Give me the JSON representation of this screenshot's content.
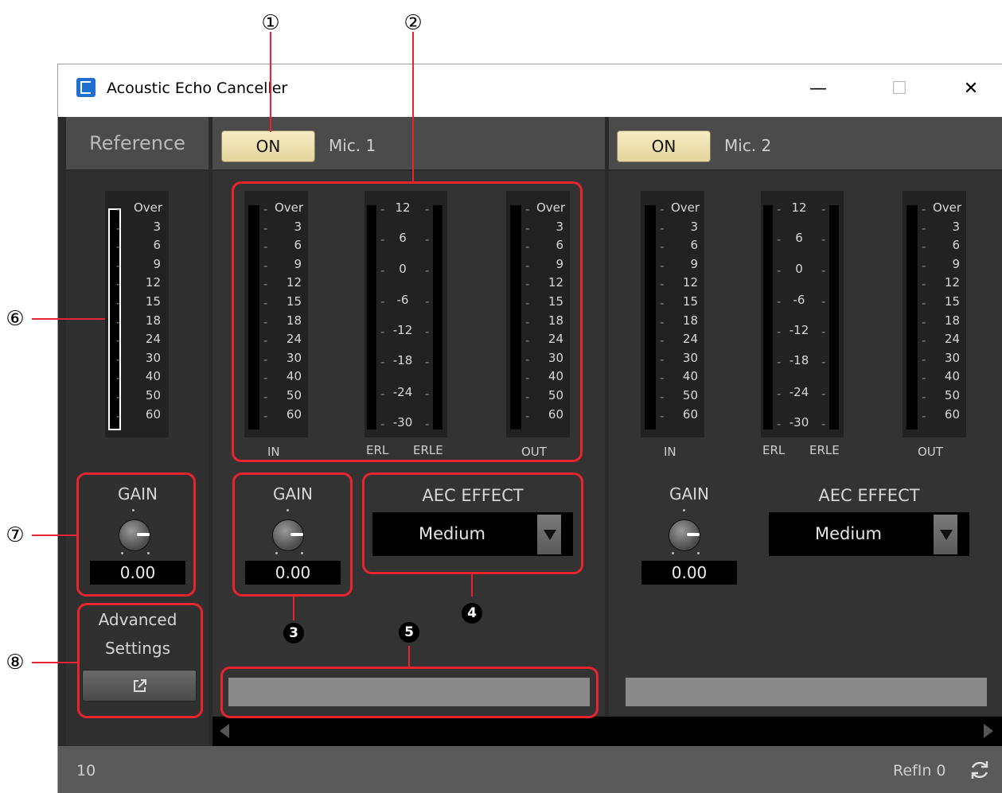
{
  "window": {
    "title": "Acoustic Echo Canceller",
    "minimize": "—",
    "maximize": "☐",
    "close": "✕"
  },
  "reference": {
    "title": "Reference",
    "meter_ticks": [
      "Over",
      "3",
      "6",
      "9",
      "12",
      "15",
      "18",
      "24",
      "30",
      "40",
      "50",
      "60"
    ],
    "gain_label": "GAIN",
    "gain_value": "0.00",
    "advanced_line1": "Advanced",
    "advanced_line2": "Settings",
    "advanced_button_icon": "external-link-icon"
  },
  "channels": [
    {
      "on_label": "ON",
      "mic_label": "Mic. 1",
      "level_ticks": [
        "Over",
        "3",
        "6",
        "9",
        "12",
        "15",
        "18",
        "24",
        "30",
        "40",
        "50",
        "60"
      ],
      "erl_ticks": [
        "12",
        "6",
        "0",
        "-6",
        "-12",
        "-18",
        "-24",
        "-30"
      ],
      "foot_in": "IN",
      "foot_erl": "ERL",
      "foot_erle": "ERLE",
      "foot_out": "OUT",
      "gain_label": "GAIN",
      "gain_value": "0.00",
      "aec_label": "AEC EFFECT",
      "aec_value": "Medium"
    },
    {
      "on_label": "ON",
      "mic_label": "Mic. 2",
      "level_ticks": [
        "Over",
        "3",
        "6",
        "9",
        "12",
        "15",
        "18",
        "24",
        "30",
        "40",
        "50",
        "60"
      ],
      "erl_ticks": [
        "12",
        "6",
        "0",
        "-6",
        "-12",
        "-18",
        "-24",
        "-30"
      ],
      "foot_in": "IN",
      "foot_erl": "ERL",
      "foot_erle": "ERLE",
      "foot_out": "OUT",
      "gain_label": "GAIN",
      "gain_value": "0.00",
      "aec_label": "AEC EFFECT",
      "aec_value": "Medium"
    }
  ],
  "footer": {
    "left": "10",
    "right": "RefIn 0",
    "refresh_icon": "refresh-icon"
  },
  "callouts": {
    "n1": "①",
    "n2": "②",
    "n3": "3",
    "n4": "4",
    "n5": "5",
    "n6": "⑥",
    "n7": "⑦",
    "n8": "⑧"
  },
  "colors": {
    "callout": "#e8242e",
    "on_button": "#efe2b0",
    "panel": "#333333"
  }
}
